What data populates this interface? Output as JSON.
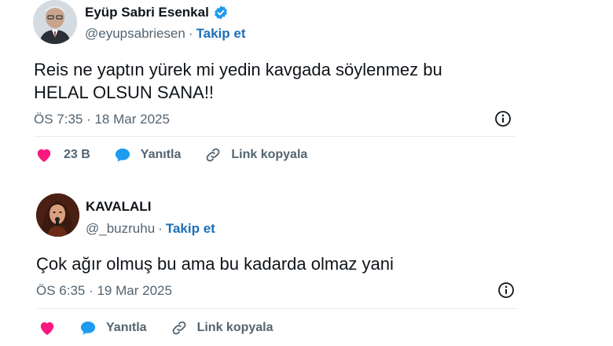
{
  "tweets": [
    {
      "display_name": "Eyüp Sabri Esenkal",
      "verified": true,
      "handle": "@eyupsabriesen",
      "separator": "·",
      "follow_label": "Takip et",
      "text_lines": [
        "Reis ne yaptın yürek mi yedin kavgada söylenmez bu",
        "HELAL OLSUN SANA!!"
      ],
      "timestamp": "ÖS 7:35 · 18 Mar 2025",
      "like_count": "23 B",
      "reply_label": "Yanıtla",
      "copy_link_label": "Link kopyala"
    },
    {
      "display_name": "KAVALALI",
      "verified": false,
      "handle": "@_buzruhu",
      "separator": "·",
      "follow_label": "Takip et",
      "text_lines": [
        "Çok ağır olmuş bu ama bu kadarda olmaz yani"
      ],
      "timestamp": "ÖS 6:35 · 19 Mar 2025",
      "like_count": "",
      "reply_label": "Yanıtla",
      "copy_link_label": "Link kopyala"
    }
  ],
  "colors": {
    "like_pink": "#f91880",
    "reply_blue": "#1d9bf0",
    "verified_blue": "#1d9bf0",
    "follow_blue": "#1d6fb8",
    "secondary_text": "#536471"
  },
  "icons": {
    "verified": "verified-badge-icon",
    "info": "info-icon",
    "like": "heart-icon",
    "reply": "speech-bubble-icon",
    "copy_link": "link-icon"
  }
}
